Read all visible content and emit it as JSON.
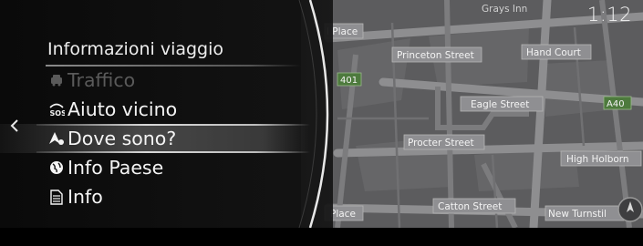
{
  "clock": "1:12",
  "menu": {
    "title": "Informazioni viaggio",
    "items": [
      {
        "label": "Traffico",
        "icon": "traffic-icon"
      },
      {
        "label": "Aiuto vicino",
        "icon": "sos-icon"
      },
      {
        "label": "Dove sono?",
        "icon": "where-am-i-icon"
      },
      {
        "label": "Info Paese",
        "icon": "globe-icon"
      },
      {
        "label": "Info",
        "icon": "document-icon"
      }
    ]
  },
  "map": {
    "streets": {
      "grays_inn": "Grays Inn",
      "place_top": "l Place",
      "princeton": "Princeton Street",
      "hand_court": "Hand Court",
      "road_401": "401",
      "eagle": "Eagle Street",
      "a40": "A40",
      "procter": "Procter Street",
      "high_holborn": "High Holborn",
      "place_bottom": "Place",
      "catton": "Catton Street",
      "new_turnstile": "New Turnstil"
    }
  }
}
